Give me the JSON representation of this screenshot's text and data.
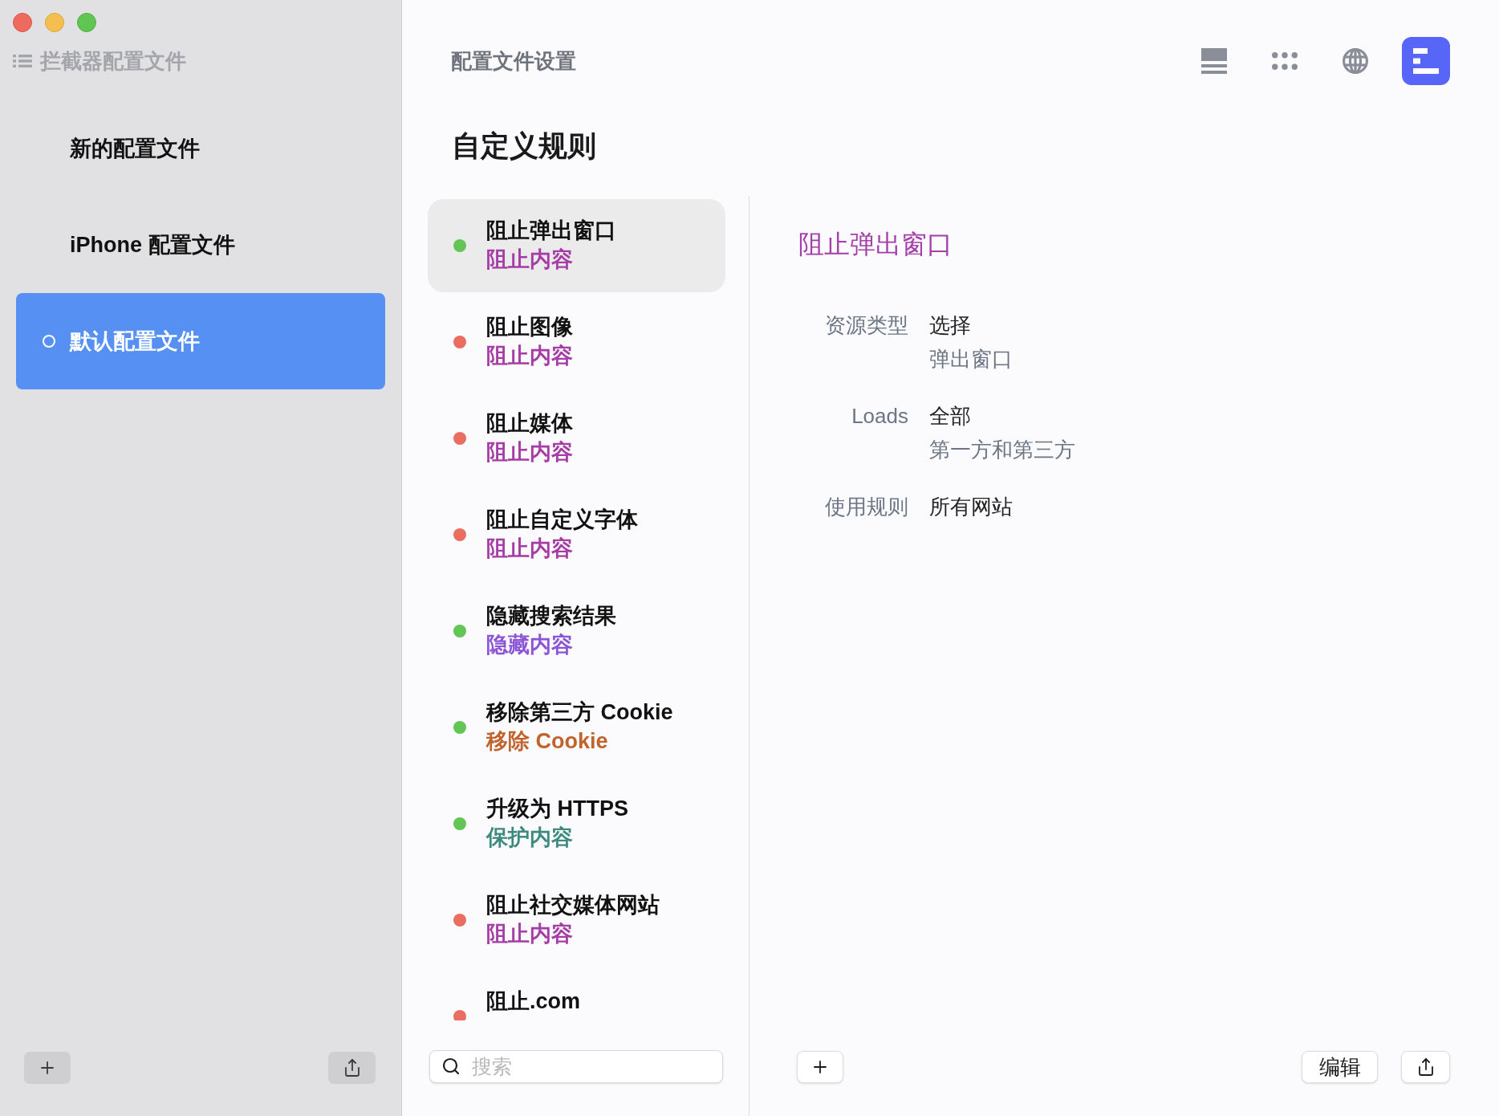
{
  "sidebar": {
    "heading": "拦截器配置文件",
    "profiles": [
      {
        "name": "新的配置文件",
        "selected": false
      },
      {
        "name": "iPhone 配置文件",
        "selected": false
      },
      {
        "name": "默认配置文件",
        "selected": true
      }
    ]
  },
  "header": {
    "title": "配置文件设置",
    "toolbar": [
      {
        "selected": false
      },
      {
        "selected": false
      },
      {
        "selected": false
      },
      {
        "selected": true
      }
    ]
  },
  "rules": {
    "title": "自定义规则",
    "items": [
      {
        "title": "阻止弹出窗口",
        "category": {
          "text": "阻止内容",
          "color": "#a63ca6"
        },
        "status": {
          "color": "#62c554"
        },
        "selected": true
      },
      {
        "title": "阻止图像",
        "category": {
          "text": "阻止内容",
          "color": "#a63ca6"
        },
        "status": {
          "color": "#eb6c61"
        },
        "selected": false
      },
      {
        "title": "阻止媒体",
        "category": {
          "text": "阻止内容",
          "color": "#a63ca6"
        },
        "status": {
          "color": "#eb6c61"
        },
        "selected": false
      },
      {
        "title": "阻止自定义字体",
        "category": {
          "text": "阻止内容",
          "color": "#a63ca6"
        },
        "status": {
          "color": "#eb6c61"
        },
        "selected": false
      },
      {
        "title": "隐藏搜索结果",
        "category": {
          "text": "隐藏内容",
          "color": "#8b55d6"
        },
        "status": {
          "color": "#62c554"
        },
        "selected": false
      },
      {
        "title": "移除第三方 Cookie",
        "category": {
          "text": "移除 Cookie",
          "color": "#c0632d"
        },
        "status": {
          "color": "#62c554"
        },
        "selected": false
      },
      {
        "title": "升级为 HTTPS",
        "category": {
          "text": "保护内容",
          "color": "#3f8a7f"
        },
        "status": {
          "color": "#62c554"
        },
        "selected": false
      },
      {
        "title": "阻止社交媒体网站",
        "category": {
          "text": "阻止内容",
          "color": "#a63ca6"
        },
        "status": {
          "color": "#eb6c61"
        },
        "selected": false
      },
      {
        "title": "阻止.com",
        "status": {
          "color": "#eb6c61"
        },
        "selected": false
      }
    ],
    "search": {
      "placeholder": "搜索"
    }
  },
  "detail": {
    "title": "阻止弹出窗口",
    "fields": [
      {
        "label": "资源类型",
        "value": "选择",
        "note": "弹出窗口"
      },
      {
        "label": "Loads",
        "value": "全部",
        "note": "第一方和第三方"
      },
      {
        "label": "使用规则",
        "value": "所有网站"
      }
    ],
    "edit_button": "编辑"
  }
}
